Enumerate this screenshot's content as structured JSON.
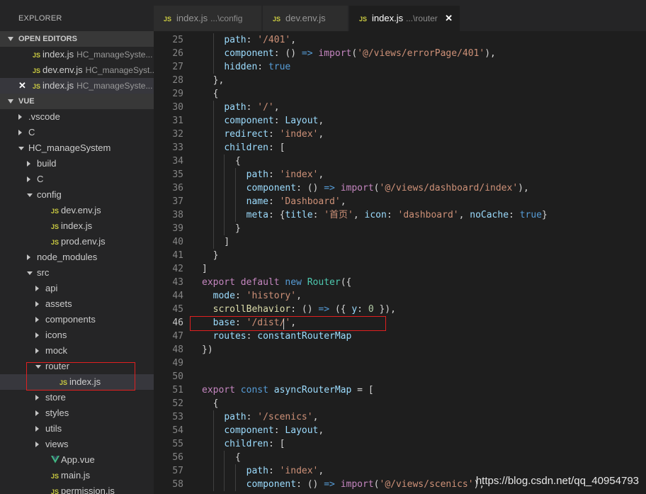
{
  "sidebar": {
    "title": "EXPLORER",
    "open_editors": {
      "header": "OPEN EDITORS",
      "items": [
        {
          "icon": "JS",
          "name": "index.js",
          "desc": "HC_manageSyste..."
        },
        {
          "icon": "JS",
          "name": "dev.env.js",
          "desc": "HC_manageSyst..."
        },
        {
          "icon": "JS",
          "name": "index.js",
          "desc": "HC_manageSyste...",
          "close": "✕"
        }
      ]
    },
    "vue": {
      "header": "VUE",
      "tree": [
        {
          "label": ".vscode"
        },
        {
          "label": "C"
        },
        {
          "label": "HC_manageSystem"
        },
        {
          "label": "build"
        },
        {
          "label": "C"
        },
        {
          "label": "config"
        },
        {
          "label": "dev.env.js",
          "icon": "JS"
        },
        {
          "label": "index.js",
          "icon": "JS"
        },
        {
          "label": "prod.env.js",
          "icon": "JS"
        },
        {
          "label": "node_modules"
        },
        {
          "label": "src"
        },
        {
          "label": "api"
        },
        {
          "label": "assets"
        },
        {
          "label": "components"
        },
        {
          "label": "icons"
        },
        {
          "label": "mock"
        },
        {
          "label": "router"
        },
        {
          "label": "index.js",
          "icon": "JS"
        },
        {
          "label": "store"
        },
        {
          "label": "styles"
        },
        {
          "label": "utils"
        },
        {
          "label": "views"
        },
        {
          "label": "App.vue",
          "icon": "vue"
        },
        {
          "label": "main.js",
          "icon": "JS"
        },
        {
          "label": "permission.js",
          "icon": "JS"
        }
      ]
    }
  },
  "tabs": [
    {
      "icon": "JS",
      "name": "index.js",
      "desc": "...\\config"
    },
    {
      "icon": "JS",
      "name": "dev.env.js",
      "desc": ""
    },
    {
      "icon": "JS",
      "name": "index.js",
      "desc": "...\\router",
      "close": "✕"
    }
  ],
  "editor": {
    "active_line": "46",
    "lines": [
      {
        "n": "25",
        "t": [
          [
            "    ",
            "plain"
          ],
          [
            "path",
            "prop"
          ],
          [
            ": ",
            "plain"
          ],
          [
            "'/401'",
            "str"
          ],
          [
            ",",
            "plain"
          ]
        ]
      },
      {
        "n": "26",
        "t": [
          [
            "    ",
            "plain"
          ],
          [
            "component",
            "prop"
          ],
          [
            ": () ",
            "plain"
          ],
          [
            "=>",
            "op"
          ],
          [
            " ",
            "plain"
          ],
          [
            "import",
            "kwc"
          ],
          [
            "(",
            "plain"
          ],
          [
            "'@/views/errorPage/401'",
            "str"
          ],
          [
            "),",
            "plain"
          ]
        ]
      },
      {
        "n": "27",
        "t": [
          [
            "    ",
            "plain"
          ],
          [
            "hidden",
            "prop"
          ],
          [
            ": ",
            "plain"
          ],
          [
            "true",
            "bool"
          ]
        ]
      },
      {
        "n": "28",
        "t": [
          [
            "  },",
            "plain"
          ]
        ]
      },
      {
        "n": "29",
        "t": [
          [
            "  {",
            "plain"
          ]
        ]
      },
      {
        "n": "30",
        "t": [
          [
            "    ",
            "plain"
          ],
          [
            "path",
            "prop"
          ],
          [
            ": ",
            "plain"
          ],
          [
            "'/'",
            "str"
          ],
          [
            ",",
            "plain"
          ]
        ]
      },
      {
        "n": "31",
        "t": [
          [
            "    ",
            "plain"
          ],
          [
            "component",
            "prop"
          ],
          [
            ": ",
            "plain"
          ],
          [
            "Layout",
            "prop"
          ],
          [
            ",",
            "plain"
          ]
        ]
      },
      {
        "n": "32",
        "t": [
          [
            "    ",
            "plain"
          ],
          [
            "redirect",
            "prop"
          ],
          [
            ": ",
            "plain"
          ],
          [
            "'index'",
            "str"
          ],
          [
            ",",
            "plain"
          ]
        ]
      },
      {
        "n": "33",
        "t": [
          [
            "    ",
            "plain"
          ],
          [
            "children",
            "prop"
          ],
          [
            ": [",
            "plain"
          ]
        ]
      },
      {
        "n": "34",
        "t": [
          [
            "      {",
            "plain"
          ]
        ]
      },
      {
        "n": "35",
        "t": [
          [
            "        ",
            "plain"
          ],
          [
            "path",
            "prop"
          ],
          [
            ": ",
            "plain"
          ],
          [
            "'index'",
            "str"
          ],
          [
            ",",
            "plain"
          ]
        ]
      },
      {
        "n": "36",
        "t": [
          [
            "        ",
            "plain"
          ],
          [
            "component",
            "prop"
          ],
          [
            ": () ",
            "plain"
          ],
          [
            "=>",
            "op"
          ],
          [
            " ",
            "plain"
          ],
          [
            "import",
            "kwc"
          ],
          [
            "(",
            "plain"
          ],
          [
            "'@/views/dashboard/index'",
            "str"
          ],
          [
            "),",
            "plain"
          ]
        ]
      },
      {
        "n": "37",
        "t": [
          [
            "        ",
            "plain"
          ],
          [
            "name",
            "prop"
          ],
          [
            ": ",
            "plain"
          ],
          [
            "'Dashboard'",
            "str"
          ],
          [
            ",",
            "plain"
          ]
        ]
      },
      {
        "n": "38",
        "t": [
          [
            "        ",
            "plain"
          ],
          [
            "meta",
            "prop"
          ],
          [
            ": {",
            "plain"
          ],
          [
            "title",
            "prop"
          ],
          [
            ": ",
            "plain"
          ],
          [
            "'首页'",
            "str"
          ],
          [
            ", ",
            "plain"
          ],
          [
            "icon",
            "prop"
          ],
          [
            ": ",
            "plain"
          ],
          [
            "'dashboard'",
            "str"
          ],
          [
            ", ",
            "plain"
          ],
          [
            "noCache",
            "prop"
          ],
          [
            ": ",
            "plain"
          ],
          [
            "true",
            "bool"
          ],
          [
            "}",
            "plain"
          ]
        ]
      },
      {
        "n": "39",
        "t": [
          [
            "      }",
            "plain"
          ]
        ]
      },
      {
        "n": "40",
        "t": [
          [
            "    ]",
            "plain"
          ]
        ]
      },
      {
        "n": "41",
        "t": [
          [
            "  }",
            "plain"
          ]
        ]
      },
      {
        "n": "42",
        "t": [
          [
            "]",
            "plain"
          ]
        ]
      },
      {
        "n": "43",
        "t": [
          [
            "export",
            "kwc"
          ],
          [
            " ",
            "plain"
          ],
          [
            "default",
            "kwc"
          ],
          [
            " ",
            "plain"
          ],
          [
            "new",
            "kw"
          ],
          [
            " ",
            "plain"
          ],
          [
            "Router",
            "type"
          ],
          [
            "({",
            "plain"
          ]
        ]
      },
      {
        "n": "44",
        "t": [
          [
            "  ",
            "plain"
          ],
          [
            "mode",
            "prop"
          ],
          [
            ": ",
            "plain"
          ],
          [
            "'history'",
            "str"
          ],
          [
            ",",
            "plain"
          ]
        ]
      },
      {
        "n": "45",
        "t": [
          [
            "  ",
            "plain"
          ],
          [
            "scrollBehavior",
            "fn"
          ],
          [
            ": () ",
            "plain"
          ],
          [
            "=>",
            "op"
          ],
          [
            " ({ ",
            "plain"
          ],
          [
            "y",
            "prop"
          ],
          [
            ": ",
            "plain"
          ],
          [
            "0",
            "num"
          ],
          [
            " }),",
            "plain"
          ]
        ]
      },
      {
        "n": "46",
        "t": [
          [
            "  ",
            "plain"
          ],
          [
            "base",
            "prop"
          ],
          [
            ": ",
            "plain"
          ],
          [
            "'/dist/'",
            "str"
          ],
          [
            ",",
            "plain"
          ]
        ]
      },
      {
        "n": "47",
        "t": [
          [
            "  ",
            "plain"
          ],
          [
            "routes",
            "prop"
          ],
          [
            ": ",
            "plain"
          ],
          [
            "constantRouterMap",
            "prop"
          ]
        ]
      },
      {
        "n": "48",
        "t": [
          [
            "})",
            "plain"
          ]
        ]
      },
      {
        "n": "49",
        "t": []
      },
      {
        "n": "50",
        "t": []
      },
      {
        "n": "51",
        "t": [
          [
            "export",
            "kwc"
          ],
          [
            " ",
            "plain"
          ],
          [
            "const",
            "kw"
          ],
          [
            " ",
            "plain"
          ],
          [
            "asyncRouterMap",
            "prop"
          ],
          [
            " = [",
            "plain"
          ]
        ]
      },
      {
        "n": "52",
        "t": [
          [
            "  {",
            "plain"
          ]
        ]
      },
      {
        "n": "53",
        "t": [
          [
            "    ",
            "plain"
          ],
          [
            "path",
            "prop"
          ],
          [
            ": ",
            "plain"
          ],
          [
            "'/scenics'",
            "str"
          ],
          [
            ",",
            "plain"
          ]
        ]
      },
      {
        "n": "54",
        "t": [
          [
            "    ",
            "plain"
          ],
          [
            "component",
            "prop"
          ],
          [
            ": ",
            "plain"
          ],
          [
            "Layout",
            "prop"
          ],
          [
            ",",
            "plain"
          ]
        ]
      },
      {
        "n": "55",
        "t": [
          [
            "    ",
            "plain"
          ],
          [
            "children",
            "prop"
          ],
          [
            ": [",
            "plain"
          ]
        ]
      },
      {
        "n": "56",
        "t": [
          [
            "      {",
            "plain"
          ]
        ]
      },
      {
        "n": "57",
        "t": [
          [
            "        ",
            "plain"
          ],
          [
            "path",
            "prop"
          ],
          [
            ": ",
            "plain"
          ],
          [
            "'index'",
            "str"
          ],
          [
            ",",
            "plain"
          ]
        ]
      },
      {
        "n": "58",
        "t": [
          [
            "        ",
            "plain"
          ],
          [
            "component",
            "prop"
          ],
          [
            ": () ",
            "plain"
          ],
          [
            "=>",
            "op"
          ],
          [
            " ",
            "plain"
          ],
          [
            "import",
            "kwc"
          ],
          [
            "(",
            "plain"
          ],
          [
            "'@/views/scenics'",
            "str"
          ],
          [
            "),",
            "plain"
          ]
        ]
      }
    ]
  },
  "watermark": "https://blog.csdn.net/qq_40954793",
  "colors": {
    "accent_box": "#e02020",
    "js_badge": "#cbcb41",
    "vue_green": "#41b883"
  }
}
